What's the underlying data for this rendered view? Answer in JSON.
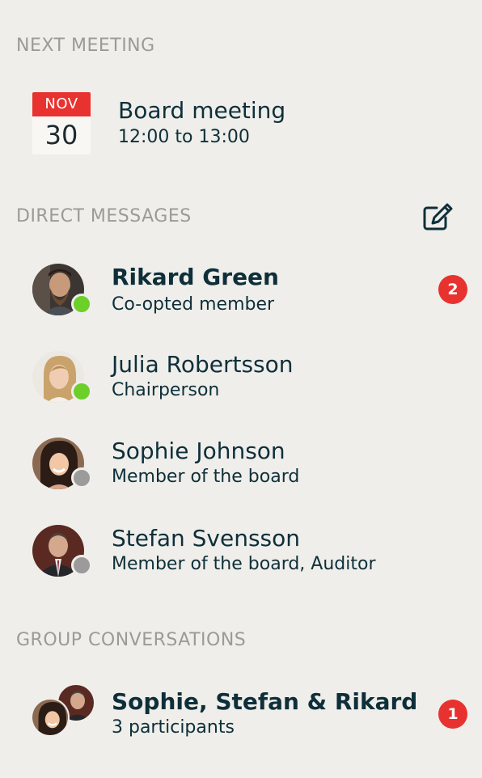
{
  "next_meeting": {
    "section_title": "NEXT MEETING",
    "month": "NOV",
    "day": "30",
    "title": "Board meeting",
    "time": "12:00 to 13:00"
  },
  "direct_messages": {
    "section_title": "DIRECT MESSAGES",
    "items": [
      {
        "name": "Rikard Green",
        "role": "Co-opted member",
        "status": "online",
        "unread": "2"
      },
      {
        "name": "Julia Robertsson",
        "role": "Chairperson",
        "status": "online"
      },
      {
        "name": "Sophie Johnson",
        "role": "Member of the board",
        "status": "offline"
      },
      {
        "name": "Stefan Svensson",
        "role": "Member of the board, Auditor",
        "status": "offline"
      }
    ]
  },
  "group_conversations": {
    "section_title": "GROUP CONVERSATIONS",
    "items": [
      {
        "name": "Sophie, Stefan & Rikard",
        "participants": "3 participants",
        "unread": "1"
      }
    ]
  },
  "colors": {
    "background": "#efeeea",
    "accent_red": "#e8322f",
    "online_green": "#6ccf2a",
    "offline_grey": "#9b9b9b",
    "text_dark": "#0e2f3a"
  }
}
